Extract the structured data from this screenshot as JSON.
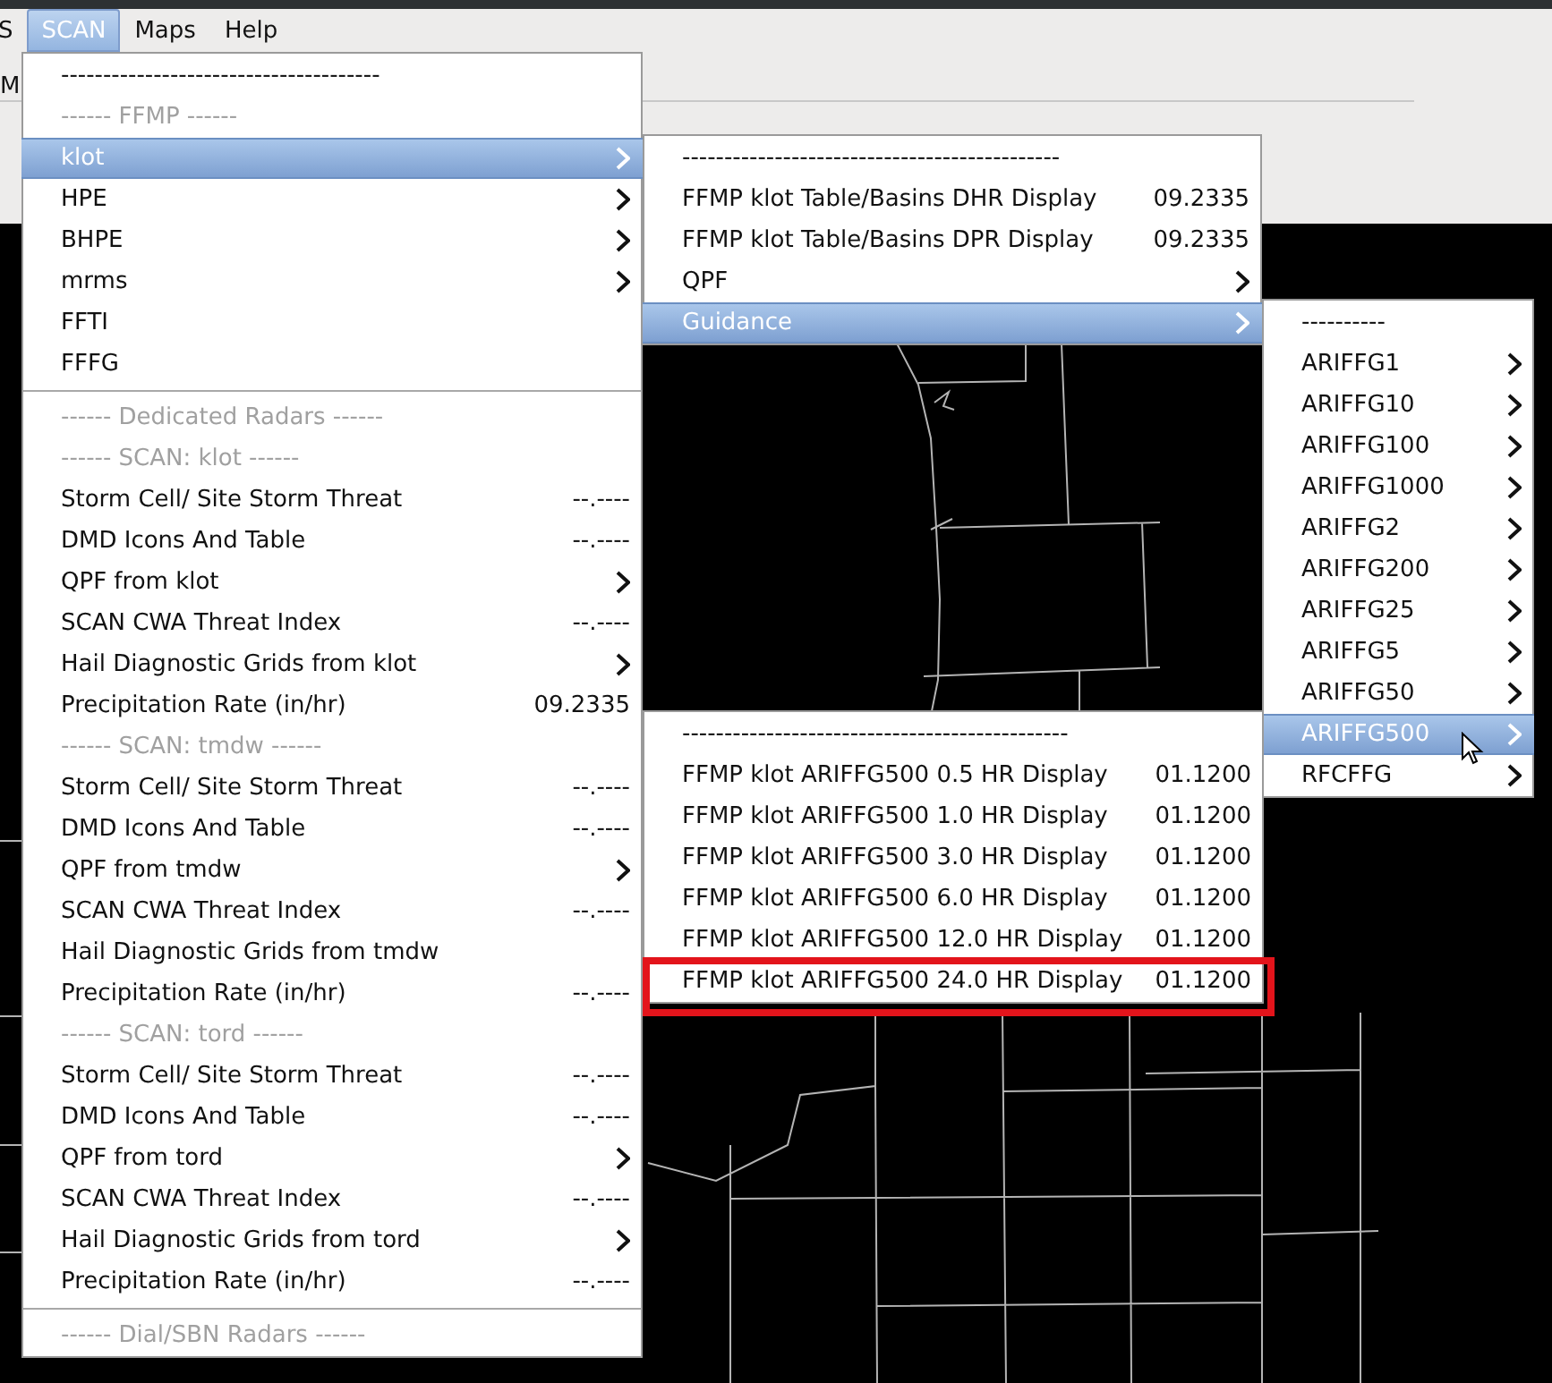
{
  "menubar": {
    "items": [
      {
        "label": "S",
        "selected": false
      },
      {
        "label": "SCAN",
        "selected": true
      },
      {
        "label": "Maps",
        "selected": false
      },
      {
        "label": "Help",
        "selected": false
      }
    ]
  },
  "toolbar": {
    "label": "M"
  },
  "menus": [
    {
      "items": [
        {
          "kind": "item",
          "label": "--------------------------------------",
          "selected": false
        },
        {
          "kind": "header",
          "label": "------ FFMP ------"
        },
        {
          "kind": "submenu",
          "label": "klot",
          "selected": true
        },
        {
          "kind": "submenu",
          "label": "HPE",
          "selected": false
        },
        {
          "kind": "submenu",
          "label": "BHPE",
          "selected": false
        },
        {
          "kind": "submenu",
          "label": "mrms",
          "selected": false
        },
        {
          "kind": "item",
          "label": "FFTI",
          "selected": false
        },
        {
          "kind": "item",
          "label": "FFFG",
          "selected": false
        },
        {
          "kind": "rule"
        },
        {
          "kind": "header",
          "label": "------ Dedicated Radars ------"
        },
        {
          "kind": "header",
          "label": "------ SCAN: klot ------"
        },
        {
          "kind": "item",
          "label": "Storm Cell/ Site Storm Threat",
          "value": "--.----",
          "selected": false
        },
        {
          "kind": "item",
          "label": "DMD Icons And Table",
          "value": "--.----",
          "selected": false
        },
        {
          "kind": "submenu",
          "label": "QPF from klot",
          "selected": false
        },
        {
          "kind": "item",
          "label": "SCAN CWA Threat Index",
          "value": "--.----",
          "selected": false
        },
        {
          "kind": "submenu",
          "label": "Hail Diagnostic Grids from klot",
          "selected": false
        },
        {
          "kind": "item",
          "label": "Precipitation Rate (in/hr)",
          "value": "09.2335",
          "selected": false
        },
        {
          "kind": "header",
          "label": "------ SCAN: tmdw ------"
        },
        {
          "kind": "item",
          "label": "Storm Cell/ Site Storm Threat",
          "value": "--.----",
          "selected": false
        },
        {
          "kind": "item",
          "label": "DMD Icons And Table",
          "value": "--.----",
          "selected": false
        },
        {
          "kind": "submenu",
          "label": "QPF from tmdw",
          "selected": false
        },
        {
          "kind": "item",
          "label": "SCAN CWA Threat Index",
          "value": "--.----",
          "selected": false
        },
        {
          "kind": "item",
          "label": "Hail Diagnostic Grids from tmdw",
          "selected": false
        },
        {
          "kind": "item",
          "label": "Precipitation Rate (in/hr)",
          "value": "--.----",
          "selected": false
        },
        {
          "kind": "header",
          "label": "------ SCAN: tord ------"
        },
        {
          "kind": "item",
          "label": "Storm Cell/ Site Storm Threat",
          "value": "--.----",
          "selected": false
        },
        {
          "kind": "item",
          "label": "DMD Icons And Table",
          "value": "--.----",
          "selected": false
        },
        {
          "kind": "submenu",
          "label": "QPF from tord",
          "selected": false
        },
        {
          "kind": "item",
          "label": "SCAN CWA Threat Index",
          "value": "--.----",
          "selected": false
        },
        {
          "kind": "submenu",
          "label": "Hail Diagnostic Grids from tord",
          "selected": false
        },
        {
          "kind": "item",
          "label": "Precipitation Rate (in/hr)",
          "value": "--.----",
          "selected": false
        },
        {
          "kind": "rule"
        },
        {
          "kind": "header",
          "label": "------ Dial/SBN Radars ------"
        }
      ]
    },
    {
      "items": [
        {
          "kind": "item",
          "label": "---------------------------------------------",
          "selected": false
        },
        {
          "kind": "item",
          "label": "FFMP klot Table/Basins DHR Display",
          "value": "09.2335",
          "selected": false
        },
        {
          "kind": "item",
          "label": "FFMP klot Table/Basins DPR Display",
          "value": "09.2335",
          "selected": false
        },
        {
          "kind": "submenu",
          "label": "QPF",
          "selected": false
        },
        {
          "kind": "submenu",
          "label": "Guidance",
          "selected": true
        }
      ]
    },
    {
      "items": [
        {
          "kind": "item",
          "label": "----------",
          "selected": false
        },
        {
          "kind": "submenu",
          "label": "ARIFFG1",
          "selected": false
        },
        {
          "kind": "submenu",
          "label": "ARIFFG10",
          "selected": false
        },
        {
          "kind": "submenu",
          "label": "ARIFFG100",
          "selected": false
        },
        {
          "kind": "submenu",
          "label": "ARIFFG1000",
          "selected": false
        },
        {
          "kind": "submenu",
          "label": "ARIFFG2",
          "selected": false
        },
        {
          "kind": "submenu",
          "label": "ARIFFG200",
          "selected": false
        },
        {
          "kind": "submenu",
          "label": "ARIFFG25",
          "selected": false
        },
        {
          "kind": "submenu",
          "label": "ARIFFG5",
          "selected": false
        },
        {
          "kind": "submenu",
          "label": "ARIFFG50",
          "selected": false
        },
        {
          "kind": "submenu",
          "label": "ARIFFG500",
          "selected": true
        },
        {
          "kind": "submenu",
          "label": "RFCFFG",
          "selected": false
        }
      ]
    },
    {
      "items": [
        {
          "kind": "item",
          "label": "----------------------------------------------",
          "selected": false,
          "outlined": false
        },
        {
          "kind": "item",
          "label": "FFMP klot ARIFFG500 0.5 HR Display",
          "value": "01.1200",
          "selected": false,
          "outlined": false
        },
        {
          "kind": "item",
          "label": "FFMP klot ARIFFG500 1.0 HR Display",
          "value": "01.1200",
          "selected": false,
          "outlined": false
        },
        {
          "kind": "item",
          "label": "FFMP klot ARIFFG500 3.0 HR Display",
          "value": "01.1200",
          "selected": false,
          "outlined": false
        },
        {
          "kind": "item",
          "label": "FFMP klot ARIFFG500 6.0 HR Display",
          "value": "01.1200",
          "selected": false,
          "outlined": false
        },
        {
          "kind": "item",
          "label": "FFMP klot ARIFFG500 12.0 HR Display",
          "value": "01.1200",
          "selected": false,
          "outlined": false
        },
        {
          "kind": "item",
          "label": "FFMP klot ARIFFG500 24.0 HR Display",
          "value": "01.1200",
          "selected": false,
          "outlined": true
        }
      ]
    }
  ]
}
